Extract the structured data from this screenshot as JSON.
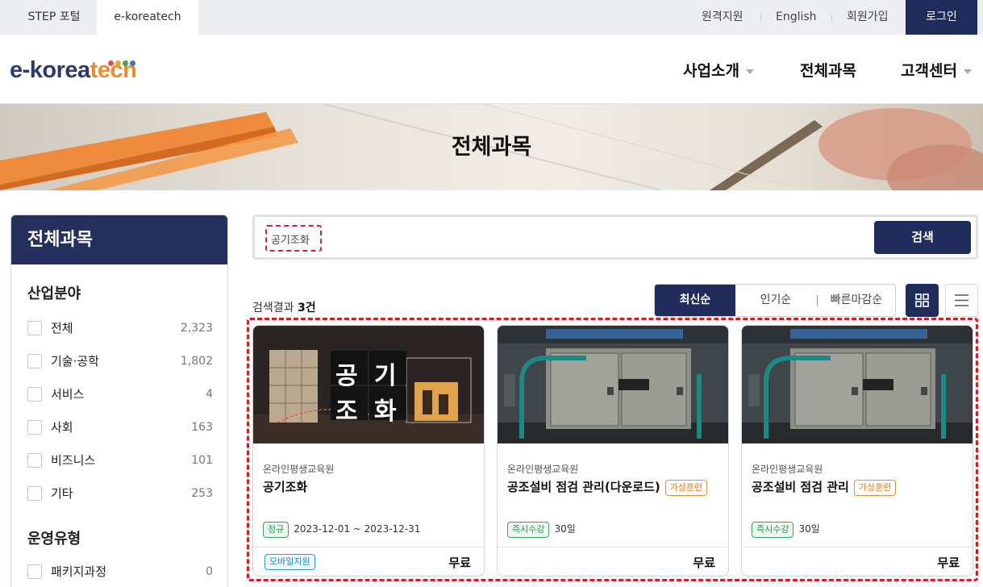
{
  "topbar": {
    "tabs": [
      "STEP 포털",
      "e-koreatech"
    ],
    "links": [
      "원격지원",
      "English",
      "회원가입"
    ],
    "login": "로그인"
  },
  "logo": {
    "part1": "e-korea",
    "part2": "tech"
  },
  "gnb": [
    "사업소개",
    "전체과목",
    "고객센터"
  ],
  "banner": {
    "title": "전체과목"
  },
  "sidebar": {
    "title": "전체과목",
    "sections": [
      {
        "title": "산업분야",
        "items": [
          {
            "label": "전체",
            "count": "2,323"
          },
          {
            "label": "기술·공학",
            "count": "1,802"
          },
          {
            "label": "서비스",
            "count": "4"
          },
          {
            "label": "사회",
            "count": "163"
          },
          {
            "label": "비즈니스",
            "count": "101"
          },
          {
            "label": "기타",
            "count": "253"
          }
        ]
      },
      {
        "title": "운영유형",
        "items": [
          {
            "label": "패키지과정",
            "count": "0"
          }
        ]
      }
    ]
  },
  "search": {
    "value": "공기조화",
    "button": "검색"
  },
  "results": {
    "prefix": "검색결과",
    "count": "3건"
  },
  "sort": [
    "최신순",
    "인기순",
    "빠른마감순"
  ],
  "cards": [
    {
      "org": "온라인평생교육원",
      "title": "공기조화",
      "tag": "",
      "period_badge": "정규",
      "period": "2023-12-01 ~ 2023-12-31",
      "mobile": "모바일지원",
      "price": "무료",
      "thumb_text": [
        "공",
        "기",
        "조",
        "화"
      ]
    },
    {
      "org": "온라인평생교육원",
      "title": "공조설비 점검 관리(다운로드)",
      "tag": "가상훈련",
      "period_badge": "즉시수강",
      "period": "30일",
      "mobile": "",
      "price": "무료"
    },
    {
      "org": "온라인평생교육원",
      "title": "공조설비 점검 관리",
      "tag": "가상훈련",
      "period_badge": "즉시수강",
      "period": "30일",
      "mobile": "",
      "price": "무료"
    }
  ],
  "colors": {
    "navy": "#1f2c5c",
    "accent_orange": "#f18a2c",
    "highlight_red": "#e01a1a",
    "badge_green": "#34a35a"
  }
}
